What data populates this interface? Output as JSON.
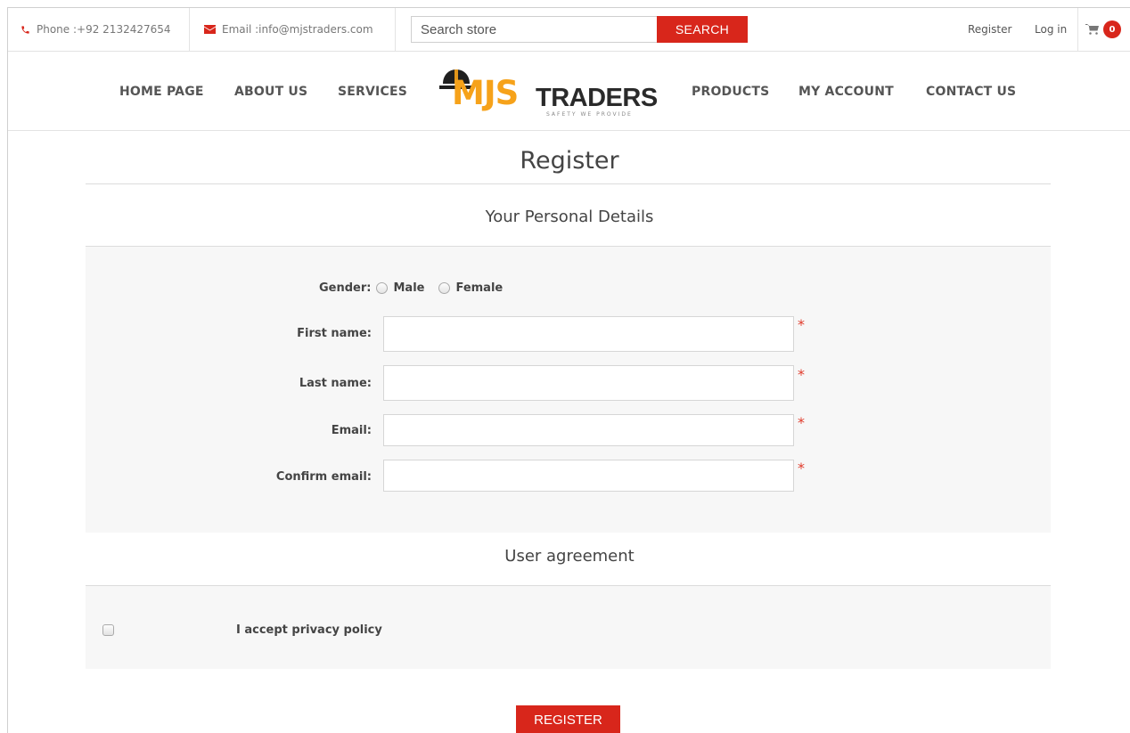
{
  "topbar": {
    "phone": "Phone :+92 2132427654",
    "email": "Email :info@mjstraders.com",
    "search_placeholder": "Search store",
    "search_button": "SEARCH",
    "register": "Register",
    "login": "Log in",
    "cart_count": "0"
  },
  "nav": {
    "items_left": [
      "HOME PAGE",
      "ABOUT US",
      "SERVICES"
    ],
    "items_right": [
      "PRODUCTS",
      "MY ACCOUNT",
      "CONTACT US"
    ],
    "logo_primary": "MJS",
    "logo_secondary": "TRADERS",
    "logo_tagline": "SAFETY WE PROVIDE"
  },
  "page": {
    "title": "Register",
    "personal_details_title": "Your Personal Details",
    "gender_label": "Gender:",
    "gender_male": "Male",
    "gender_female": "Female",
    "first_name_label": "First name:",
    "last_name_label": "Last name:",
    "email_label": "Email:",
    "confirm_email_label": "Confirm email:",
    "required_mark": "*",
    "user_agreement_title": "User agreement",
    "privacy_label": "I accept privacy policy",
    "register_button": "REGISTER"
  },
  "colors": {
    "accent": "#d8261b",
    "logo_orange": "#f6a21a",
    "required": "#e03a2a"
  }
}
